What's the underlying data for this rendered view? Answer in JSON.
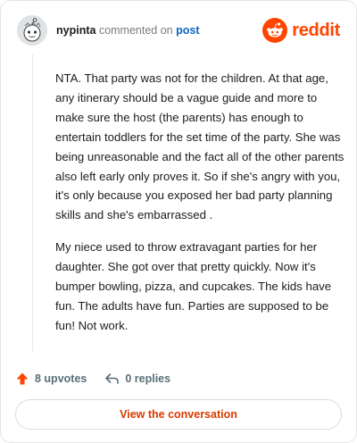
{
  "header": {
    "username": "nypinta",
    "action_text": "commented on",
    "post_link": "post",
    "brand_name": "reddit",
    "brand_color": "#ff4500",
    "avatar_icon": "snoo-avatar-icon"
  },
  "comment": {
    "paragraphs": [
      "NTA. That party was not for the children. At that age, any itinerary should be a vague guide and more to make sure the host (the parents) has enough to entertain toddlers for the set time of the party. She was being unreasonable and the fact all of the other parents also left early only proves it. So if she's angry with you, it's only because you exposed her bad party planning skills and she's embarrassed .",
      "My niece used to throw extravagant parties for her daughter. She got over that pretty quickly. Now it's bumper bowling, pizza, and cupcakes. The kids have fun. The adults have fun. Parties are supposed to be fun! Not work."
    ]
  },
  "actions": {
    "upvotes_label": "8 upvotes",
    "replies_label": "0 replies",
    "upvote_icon": "upvote-arrow-icon",
    "reply_icon": "reply-arrow-icon",
    "upvote_color": "#ff4500"
  },
  "footer": {
    "view_button_label": "View the conversation",
    "button_text_color": "#d93a00"
  }
}
